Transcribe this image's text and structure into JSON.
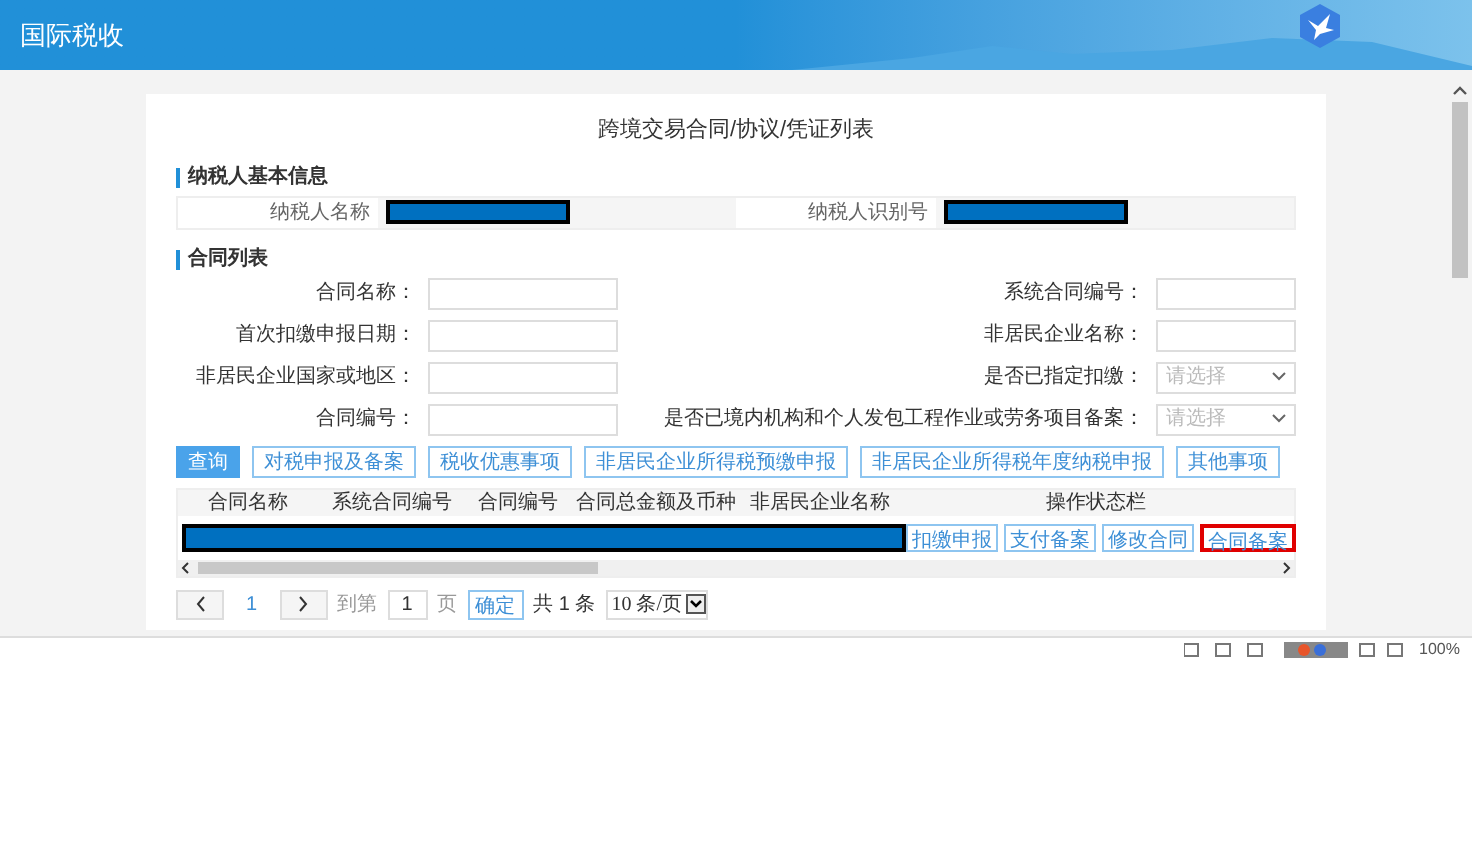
{
  "header": {
    "title": "国际税收"
  },
  "page_title": "跨境交易合同/协议/凭证列表",
  "taxpayer_section": {
    "heading": "纳税人基本信息",
    "fields": [
      {
        "label": "纳税人名称",
        "redacted": true
      },
      {
        "label": "纳税人识别号",
        "redacted": true
      }
    ]
  },
  "contract_section": {
    "heading": "合同列表",
    "filters": [
      {
        "label": "合同名称：",
        "kind": "text"
      },
      {
        "label": "系统合同编号：",
        "kind": "text"
      },
      {
        "label": "首次扣缴申报日期：",
        "kind": "text"
      },
      {
        "label": "非居民企业名称：",
        "kind": "text"
      },
      {
        "label": "非居民企业国家或地区：",
        "kind": "text"
      },
      {
        "label": "是否已指定扣缴：",
        "kind": "select",
        "placeholder": "请选择"
      },
      {
        "label": "合同编号：",
        "kind": "text"
      },
      {
        "label": "是否已境内机构和个人发包工程作业或劳务项目备案：",
        "kind": "select",
        "placeholder": "请选择"
      }
    ]
  },
  "actions": [
    {
      "label": "查询",
      "primary": true
    },
    {
      "label": "对税申报及备案",
      "primary": false
    },
    {
      "label": "税收优惠事项",
      "primary": false
    },
    {
      "label": "非居民企业所得税预缴申报",
      "primary": false
    },
    {
      "label": "非居民企业所得税年度纳税申报",
      "primary": false
    },
    {
      "label": "其他事项",
      "primary": false
    }
  ],
  "table": {
    "columns": [
      "合同名称",
      "系统合同编号",
      "合同编号",
      "合同总金额及币种",
      "非居民企业名称",
      "操作状态栏"
    ],
    "rows": [
      {
        "redacted": true,
        "actions": [
          {
            "label": "扣缴申报",
            "highlighted": false
          },
          {
            "label": "支付备案",
            "highlighted": false
          },
          {
            "label": "修改合同",
            "highlighted": false
          },
          {
            "label": "合同备案",
            "highlighted": true
          }
        ]
      }
    ]
  },
  "pagination": {
    "page": "1",
    "goto_label": "到第",
    "goto_value": "1",
    "page_unit": "页",
    "confirm": "确定",
    "total": "共 1 条",
    "page_size": "10 条/页"
  },
  "status_bar": {
    "zoom": "100%"
  }
}
